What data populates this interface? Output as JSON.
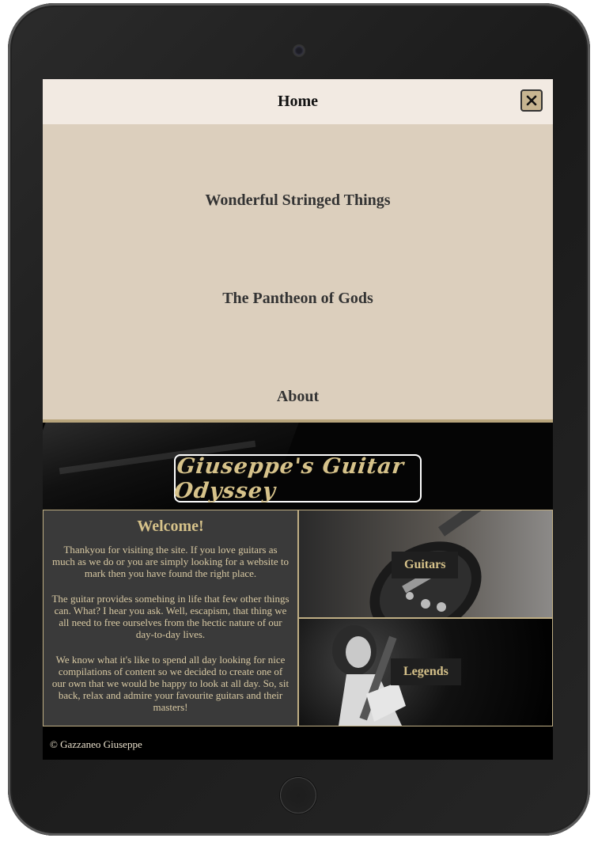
{
  "nav": {
    "title": "Home",
    "close_icon": "close-x-icon",
    "links": [
      "Wonderful Stringed Things",
      "The Pantheon of Gods",
      "About"
    ]
  },
  "hero": {
    "logo_text": "Giuseppe's Guitar Odyssey"
  },
  "welcome": {
    "heading": "Welcome!",
    "paragraphs": [
      "Thankyou for visiting the site. If you love guitars as much as we do or you are simply looking for a website to mark then you have found the right place.",
      "The guitar provides somehing in life that few other things can. What? I hear you ask. Well, escapism, that thing we all need to free ourselves from the hectic nature of our day-to-day lives.",
      "We know what it's like to spend all day looking for nice compilations of content so we decided to create one of our own that we would be happy to look at all day. So, sit back, relax and admire your favourite guitars and their masters!"
    ]
  },
  "tiles": {
    "guitars_label": "Guitars",
    "legends_label": "Legends"
  },
  "footer": {
    "copyright": "© Gazzaneo Giuseppe"
  },
  "colors": {
    "accent_gold": "#d6c28a",
    "menu_bg": "#dccfbd",
    "header_bg": "#f2eae2",
    "close_bg": "#c7b591"
  }
}
